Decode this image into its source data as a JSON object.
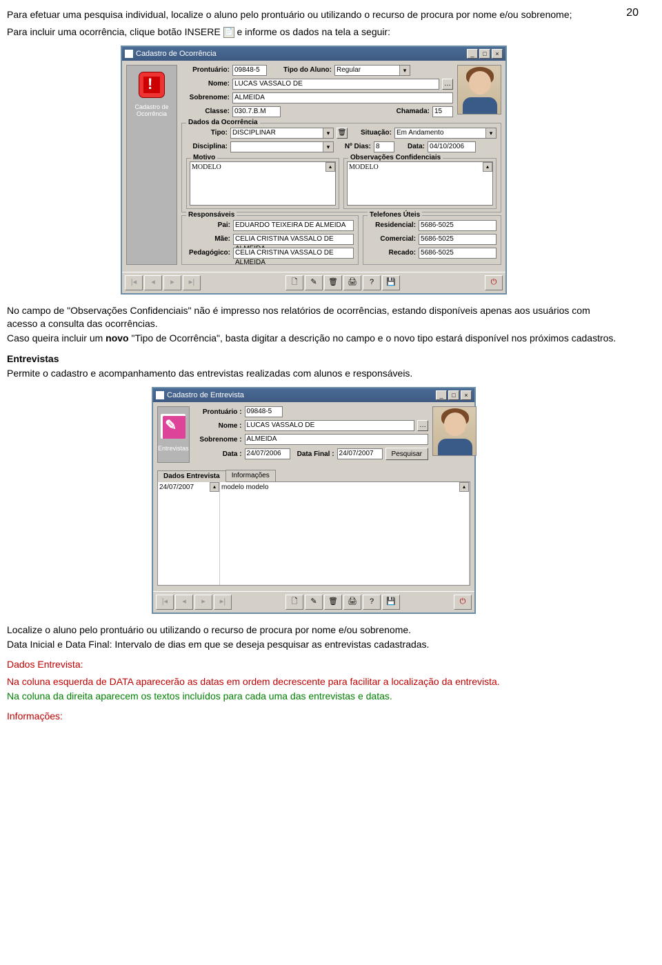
{
  "page_number": "20",
  "text": {
    "p1a": "Para efetuar uma pesquisa individual, localize o aluno pelo prontuário ou utilizando o recurso de procura por nome e/ou sobrenome;",
    "p2a": "Para incluir uma ocorrência, clique botão INSERE ",
    "p2b": " e informe os dados na tela a seguir:",
    "p3": "No campo de \"Observações Confidenciais\" não é impresso nos relatórios de ocorrências, estando disponíveis apenas aos usuários com acesso a consulta das ocorrências.",
    "p4a": "Caso queira incluir um ",
    "p4b": "novo",
    "p4c": " \"Tipo de Ocorrência\", basta digitar a descrição no campo e o novo tipo estará disponível nos próximos cadastros.",
    "h_entrevistas": "Entrevistas",
    "p5": "Permite o cadastro e acompanhamento das entrevistas realizadas com alunos e responsáveis.",
    "p6": "Localize o aluno pelo prontuário ou utilizando o recurso de procura por nome e/ou sobrenome.",
    "p7": "Data Inicial e Data Final: Intervalo de dias em que se deseja pesquisar as entrevistas cadastradas.",
    "h_dados": "Dados Entrevista:",
    "p8": "Na coluna esquerda de DATA aparecerão as datas em ordem decrescente para facilitar a localização da entrevista.",
    "p9": "Na coluna da direita aparecem os textos incluídos para cada uma das entrevistas e datas.",
    "h_info": "Informações:"
  },
  "win1": {
    "title": "Cadastro de Ocorrência",
    "side_label": "Cadastro de Ocorrência",
    "labels": {
      "prontuario": "Prontuário:",
      "tipo_aluno": "Tipo do Aluno:",
      "nome": "Nome:",
      "sobrenome": "Sobrenome:",
      "classe": "Classe:",
      "chamada": "Chamada:",
      "dados": "Dados da Ocorrência",
      "tipo": "Tipo:",
      "situacao": "Situação:",
      "disciplina": "Disciplina:",
      "ndias": "Nº Dias:",
      "data": "Data:",
      "motivo": "Motivo",
      "obs": "Observações Confidenciais",
      "resp": "Responsáveis",
      "tel": "Telefones Úteis",
      "pai": "Pai:",
      "mae": "Mãe:",
      "pedag": "Pedagógico:",
      "resid": "Residencial:",
      "comerc": "Comercial:",
      "recado": "Recado:"
    },
    "values": {
      "prontuario": "09848-5",
      "tipo_aluno": "Regular",
      "nome": "LUCAS VASSALO DE",
      "sobrenome": "ALMEIDA",
      "classe": "030.7.B.M",
      "chamada": "15",
      "tipo": "DISCIPLINAR",
      "situacao": "Em Andamento",
      "disciplina": "",
      "ndias": "8",
      "data": "04/10/2006",
      "motivo_txt": "MODELO",
      "obs_txt": "MODELO",
      "pai": "EDUARDO TEIXEIRA DE ALMEIDA",
      "mae": "CELIA CRISTINA VASSALO DE ALMEIDA",
      "pedag": "CELIA CRISTINA VASSALO DE ALMEIDA",
      "resid": "5686-5025",
      "comerc": "5686-5025",
      "recado": "5686-5025"
    }
  },
  "win2": {
    "title": "Cadastro de Entrevista",
    "side_label": "Entrevistas",
    "labels": {
      "prontuario": "Prontuário :",
      "nome": "Nome :",
      "sobrenome": "Sobrenome :",
      "data": "Data :",
      "data_final": "Data Final :",
      "pesquisar": "Pesquisar",
      "tab1": "Dados Entrevista",
      "tab2": "Informações"
    },
    "values": {
      "prontuario": "09848-5",
      "nome": "LUCAS VASSALO DE",
      "sobrenome": "ALMEIDA",
      "data": "24/07/2006",
      "data_final": "24/07/2007",
      "list_date": "24/07/2007",
      "list_text": "modelo modelo"
    }
  },
  "toolbar_glyphs": {
    "first": "|◂",
    "prev": "◂",
    "next": "▸",
    "last": "▸|",
    "new": "🗋",
    "edit": "✎",
    "del": "🗑",
    "print": "🖨",
    "help": "?",
    "save": "💾",
    "close": "⏻"
  }
}
